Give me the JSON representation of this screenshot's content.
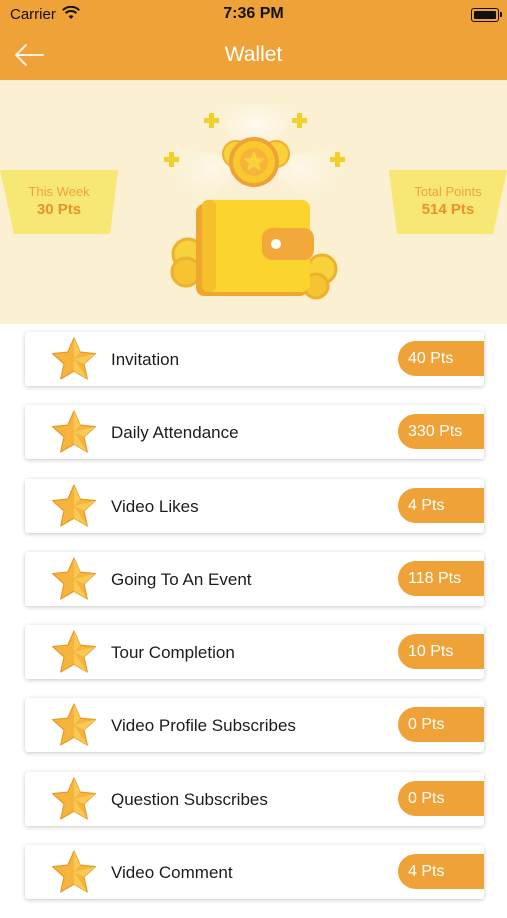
{
  "status_bar": {
    "carrier": "Carrier",
    "time": "7:36 PM"
  },
  "nav": {
    "title": "Wallet",
    "back_icon": "arrow-left-icon"
  },
  "summary": {
    "this_week": {
      "label": "This Week",
      "value": "30 Pts"
    },
    "total_points": {
      "label": "Total Points",
      "value": "514 Pts"
    }
  },
  "activities": [
    {
      "label": "Invitation",
      "points": "40 Pts"
    },
    {
      "label": "Daily Attendance",
      "points": "330 Pts"
    },
    {
      "label": "Video Likes",
      "points": "4 Pts"
    },
    {
      "label": "Going To An Event",
      "points": "118 Pts"
    },
    {
      "label": "Tour Completion",
      "points": "10 Pts"
    },
    {
      "label": "Video Profile Subscribes",
      "points": "0 Pts"
    },
    {
      "label": "Question Subscribes",
      "points": "0 Pts"
    },
    {
      "label": "Video Comment",
      "points": "4 Pts"
    }
  ],
  "colors": {
    "accent": "#eea238",
    "hero_bg": "#fbf0d2",
    "ribbon": "#f6e66a"
  }
}
